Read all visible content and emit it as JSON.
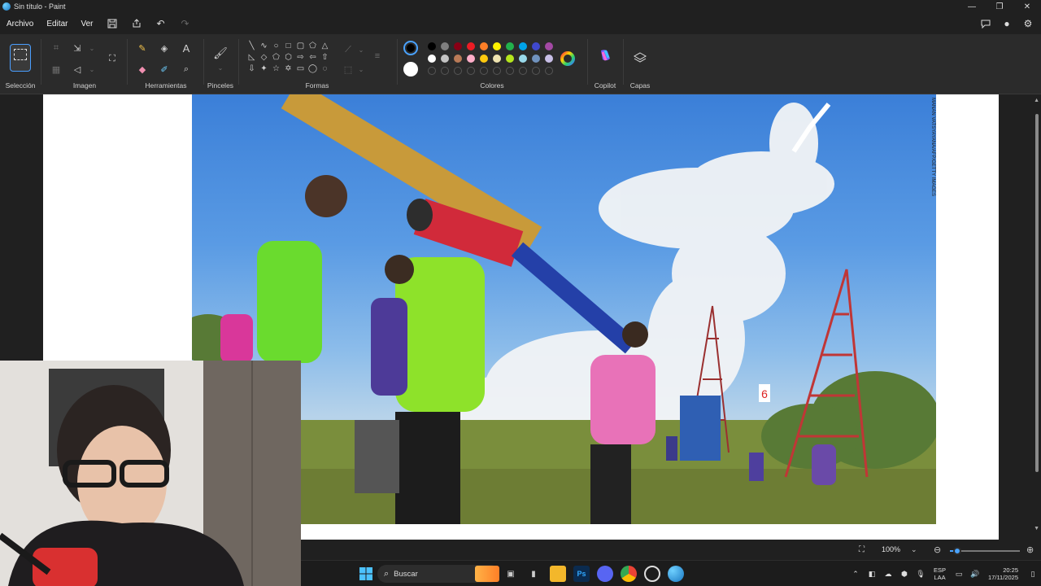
{
  "window": {
    "title": "Sin título - Paint",
    "controls": {
      "minimize": "—",
      "maximize": "❐",
      "close": "✕"
    }
  },
  "menu": {
    "items": [
      "Archivo",
      "Editar",
      "Ver"
    ]
  },
  "ribbon": {
    "groups": {
      "selection": "Selección",
      "image": "Imagen",
      "tools": "Herramientas",
      "brushes": "Pinceles",
      "shapes": "Formas",
      "colors": "Colores",
      "copilot": "Copilot",
      "layers": "Capas"
    },
    "palette_row1": [
      "#000000",
      "#7f7f7f",
      "#880015",
      "#ed1c24",
      "#ff7f27",
      "#fff200",
      "#22b14c",
      "#00a2e8",
      "#3f48cc",
      "#a349a4"
    ],
    "palette_row2": [
      "#ffffff",
      "#c3c3c3",
      "#b97a57",
      "#ffaec9",
      "#ffc90e",
      "#efe4b0",
      "#b5e61d",
      "#99d9ea",
      "#7092be",
      "#c8bfe7"
    ],
    "primary_color": "#000000",
    "secondary_color": "#ffffff"
  },
  "photo": {
    "watermark": "MANAN VATSYAYANA/AFP/GETTY IMAGES",
    "sign_number": "6"
  },
  "statusbar": {
    "zoom": "100%",
    "zoom_level": 0.1
  },
  "taskbar": {
    "search_label": "Buscar",
    "lang_line1": "ESP",
    "lang_line2": "LAA",
    "time": "20:25",
    "date": "17/11/2025"
  }
}
